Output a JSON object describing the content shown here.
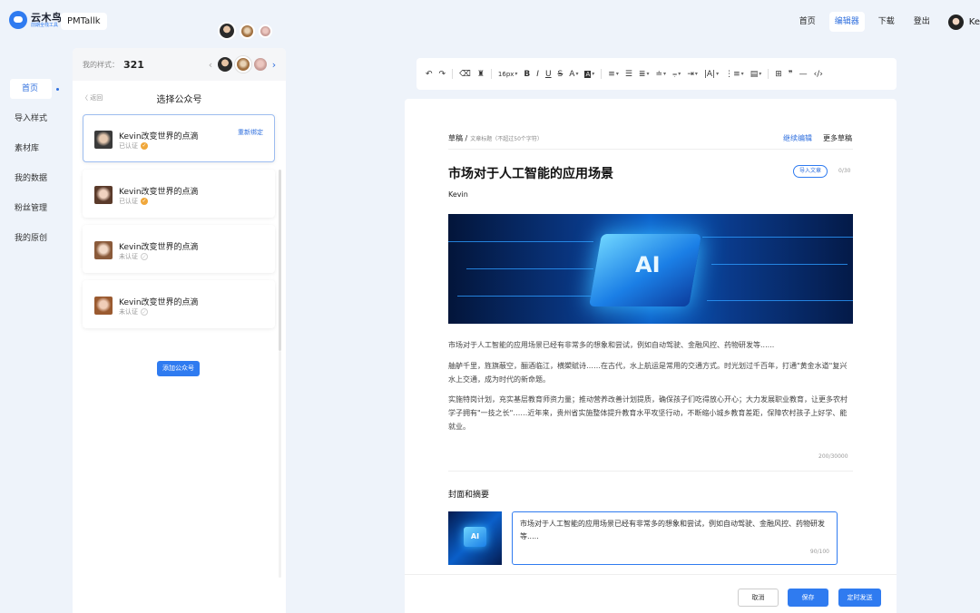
{
  "brand": {
    "logo_text": "云木鸟",
    "logo_sub": "前期全栈工具",
    "name": "PMTallk"
  },
  "topnav": {
    "home": "首页",
    "editor": "编辑器",
    "download": "下载",
    "logout": "登出",
    "user": "Ke"
  },
  "sidebar": {
    "items": [
      {
        "label": "首页",
        "active": true
      },
      {
        "label": "导入样式"
      },
      {
        "label": "素材库"
      },
      {
        "label": "我的数据"
      },
      {
        "label": "粉丝管理"
      },
      {
        "label": "我的原创"
      }
    ]
  },
  "panel": {
    "style_label": "我的样式：",
    "style_count": "321",
    "back": "〈 返回",
    "title": "选择公众号",
    "accounts": [
      {
        "name": "Kevin改变世界的点滴",
        "status": "已认证",
        "verified": true,
        "rebind": "重新绑定"
      },
      {
        "name": "Kevin改变世界的点滴",
        "status": "已认证",
        "verified": true
      },
      {
        "name": "Kevin改变世界的点滴",
        "status": "未认证",
        "verified": false
      },
      {
        "name": "Kevin改变世界的点滴",
        "status": "未认证",
        "verified": false
      }
    ],
    "add_button": "添加公众号"
  },
  "toolbar": {
    "undo": "↶",
    "redo": "↷",
    "eraser": "⌫",
    "brush": "♜",
    "font_size": "16px",
    "bold": "B",
    "italic": "I",
    "underline": "U",
    "strike": "S",
    "font_color": "A",
    "bg_color": "A"
  },
  "editor": {
    "crumb": "草稿 /",
    "crumb_hint": "文章标题（不超过50个字符）",
    "continue": "继续编辑",
    "drafts": "更多草稿",
    "title": "市场对于人工智能的应用场景",
    "import_btn": "导入文章",
    "title_count": "0/30",
    "author": "Kevin",
    "hero_label": "AI",
    "paragraphs": [
      "市场对于人工智能的应用场景已经有非常多的想象和尝试，例如自动驾驶、金融风控、药物研发等......",
      "舳舻千里，旌旗蔽空，酾酒临江，横槊赋诗……在古代，水上航运是常用的交通方式。时光划过千百年，打通\"黄金水道\"复兴水上交通，成为时代的新命题。",
      "实施特岗计划，充实基层教育师资力量；推动营养改善计划提质，确保孩子们吃得放心开心；大力发展职业教育，让更多农村学子拥有\"一技之长\"……近年来，贵州省实施整体提升教育水平攻坚行动，不断缩小城乡教育差距，保障农村孩子上好学、能就业。"
    ],
    "body_count": "200/30000",
    "cover_title": "封面和摘要",
    "cover_label": "AI",
    "summary": "市场对于人工智能的应用场景已经有非常多的想象和尝试，例如自动驾驶、金融风控、药物研发等.....",
    "summary_count": "90/100"
  },
  "actions": {
    "cancel": "取消",
    "save": "保存",
    "schedule": "定时发送"
  },
  "colors": {
    "accent": "#2f7bf0",
    "background": "#eef3fa",
    "verified": "#f0a73a"
  }
}
